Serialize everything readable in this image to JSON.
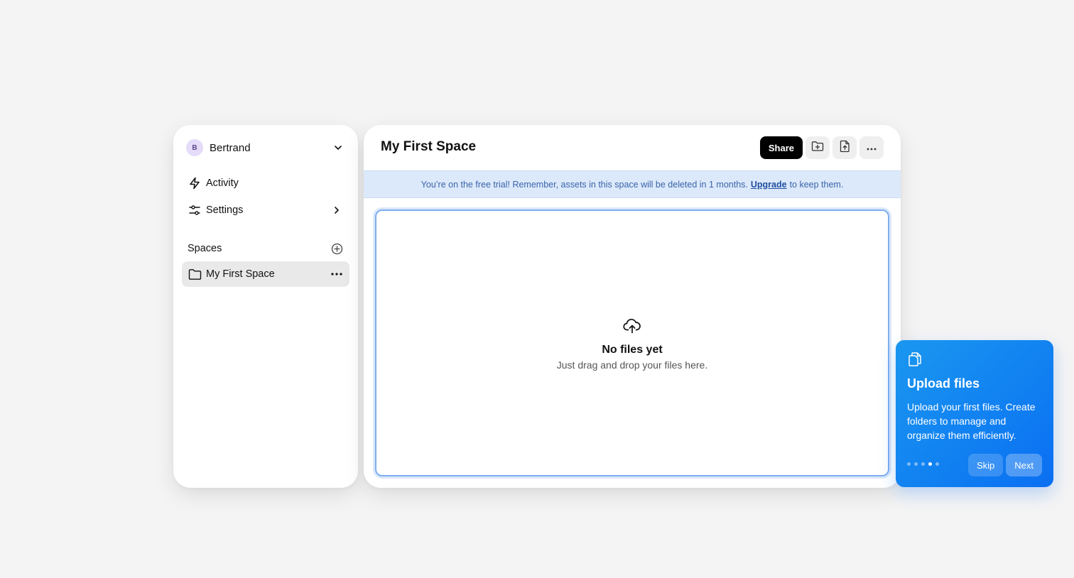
{
  "sidebar": {
    "user": {
      "initial": "B",
      "name": "Bertrand"
    },
    "nav": [
      {
        "label": "Activity",
        "icon": "bolt-icon"
      },
      {
        "label": "Settings",
        "icon": "sliders-icon"
      }
    ],
    "spaces_label": "Spaces",
    "spaces": [
      {
        "label": "My First Space",
        "icon": "folder-icon"
      }
    ]
  },
  "main": {
    "title": "My First Space",
    "share_label": "Share",
    "banner": {
      "before": "You’re on the free trial! Remember, assets in this space will be deleted in 1 months.",
      "link": "Upgrade",
      "after": "to keep them."
    },
    "empty": {
      "title": "No files yet",
      "subtitle": "Just drag and drop your files here."
    }
  },
  "tour": {
    "title": "Upload files",
    "text": "Upload your first files. Create folders to manage and organize them efficiently.",
    "step_current": 4,
    "step_total": 5,
    "skip_label": "Skip",
    "next_label": "Next"
  },
  "colors": {
    "accent": "#0a6ff2",
    "banner_bg": "#dce9fb",
    "selected_item_bg": "#e9e9e9"
  }
}
